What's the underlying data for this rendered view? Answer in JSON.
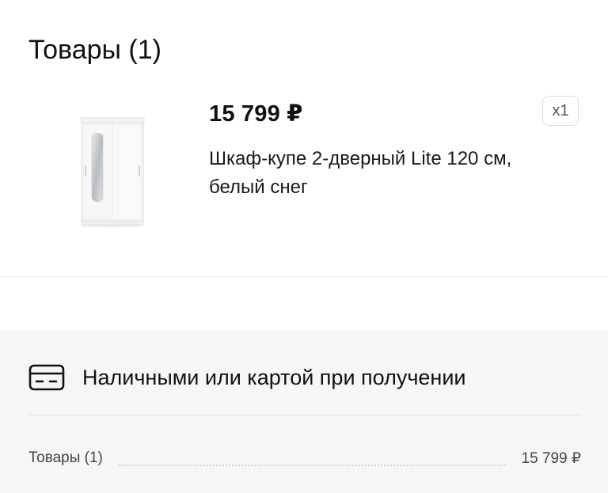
{
  "items_section": {
    "title": "Товары (1)"
  },
  "product": {
    "image_icon": "wardrobe-image",
    "price": "15 799 ₽",
    "quantity": "x1",
    "name": "Шкаф-купе 2-дверный Lite 120 см, белый снег"
  },
  "summary": {
    "payment": {
      "icon": "credit-card-icon",
      "label": "Наличными или картой при получении"
    },
    "items_total": {
      "label": "Товары (1)",
      "value": "15 799 ₽"
    }
  },
  "colors": {
    "summary_background": "#f6f6f7",
    "text": "#111111",
    "muted_text": "#444444"
  }
}
